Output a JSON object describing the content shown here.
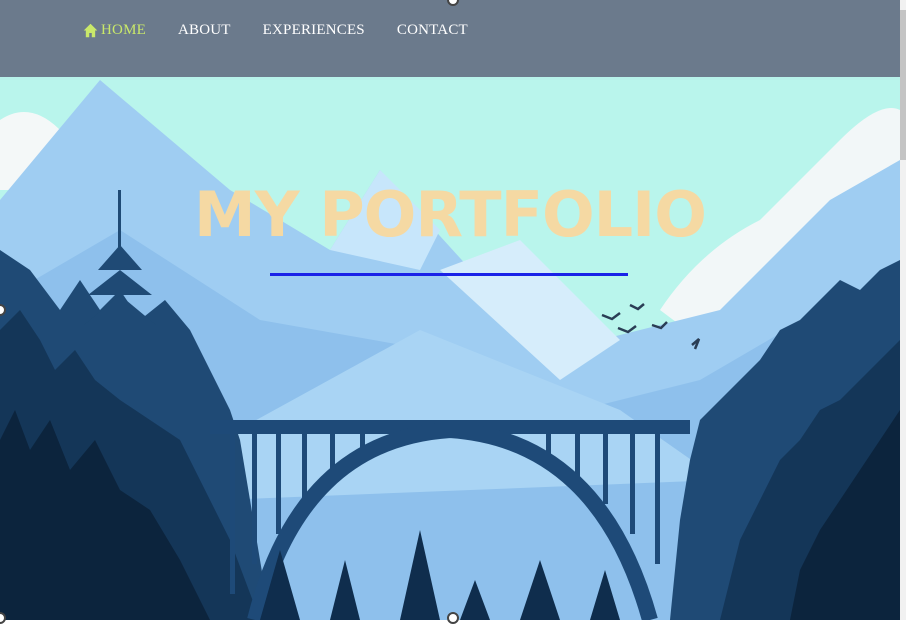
{
  "nav": {
    "items": [
      {
        "label": "HOME",
        "icon": "home-icon",
        "active": true
      },
      {
        "label": "ABOUT"
      },
      {
        "label": "EXPERIENCES"
      },
      {
        "label": "CONTACT"
      }
    ]
  },
  "hero": {
    "title": "MY PORTFOLIO"
  },
  "colors": {
    "nav_bg": "#6b7a8c",
    "nav_active": "#c9e86a",
    "title": "#f5d9a3",
    "underline": "#1a22e8",
    "sky": "#b9f5ec"
  }
}
